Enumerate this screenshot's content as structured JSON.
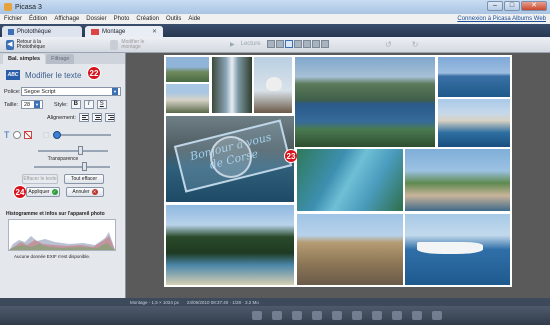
{
  "window": {
    "title": "Picasa 3"
  },
  "menu": {
    "items": [
      "Fichier",
      "Édition",
      "Affichage",
      "Dossier",
      "Photo",
      "Création",
      "Outils",
      "Aide"
    ],
    "account_link": "Connexion à Picasa Albums Web"
  },
  "tabs": [
    {
      "label": "Photothèque"
    },
    {
      "label": "Montage"
    }
  ],
  "toolbar": {
    "back_label": "Retour à la Photothèque",
    "modify_label": "Modifier le montage",
    "center_label": "Lecture"
  },
  "panel": {
    "tabs": [
      "Bal. simples",
      "Filtrage"
    ],
    "header": "Modifier le texte",
    "font_label": "Police:",
    "font_value": "Segoe Script",
    "size_label": "Taille:",
    "size_value": "28",
    "style_label": "Style:",
    "bold": "B",
    "italic": "I",
    "underline": "S",
    "align_label": "Alignement:",
    "transparency_label": "Transparence",
    "delete_text_label": "Effacer le texte",
    "clear_all_label": "Tout effacer",
    "apply_label": "Appliquer",
    "cancel_label": "Annuler",
    "histogram_title": "Histogramme et infos sur l'appareil photo",
    "exif_text": "Aucune donnée EXIF n'est disponible.",
    "badges": [
      "22",
      "24"
    ]
  },
  "montage": {
    "overlay_text": "Bonjour à vous de Corse",
    "badge": "23"
  },
  "statusbar": {
    "left": "Montage - 1,5 × 1024 px",
    "right": "24/05/2010 08:37:40 · 1/28 · 3.2 Mo"
  },
  "colors": {
    "accent": "#3b6fb6",
    "badge": "#d8131c",
    "apply_green": "#2e9e3b",
    "cancel_red": "#c0312a"
  }
}
